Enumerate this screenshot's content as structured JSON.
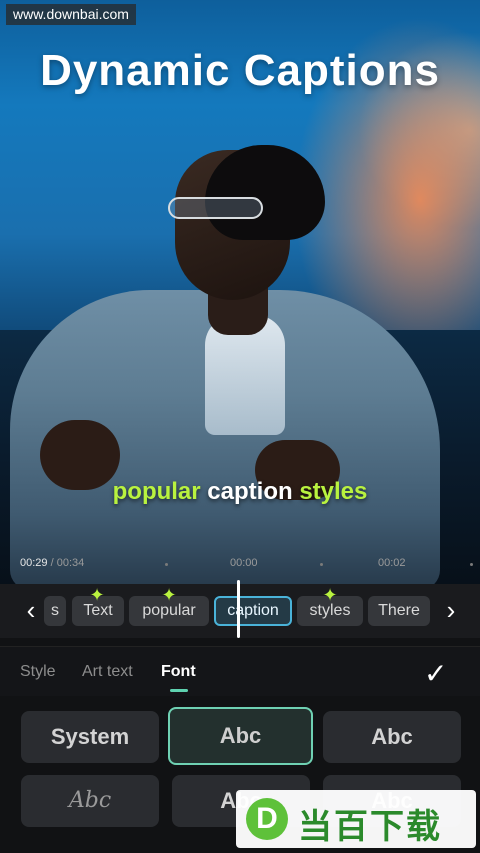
{
  "watermark": "www.downbai.com",
  "headline": "Dynamic Captions",
  "caption_overlay": {
    "word1": "popular",
    "word2": "caption",
    "word3": "styles"
  },
  "timeline": {
    "current": "00:29",
    "separator": " / ",
    "total": "00:34",
    "mark_0": "00:00",
    "mark_2": "00:02"
  },
  "caption_strip": {
    "items": [
      "s",
      "Text",
      "popular",
      "caption",
      "styles",
      "There"
    ],
    "active_index": 3,
    "left_arrow": "‹",
    "right_arrow": "›"
  },
  "tabs": {
    "items": [
      "Style",
      "Art text",
      "Font"
    ],
    "active": "Font",
    "confirm_icon": "check-icon"
  },
  "font_cards": {
    "row1": [
      "System",
      "Abc",
      "Abc"
    ],
    "row2": [
      "Abc",
      "Abc",
      "Abc"
    ]
  },
  "site_logo": {
    "badge": "D",
    "text": "当百下载"
  },
  "colors": {
    "caption_highlight": "#b9f23f",
    "accent_teal": "#6fd1b3",
    "chip_active_border": "#4ab3d9"
  }
}
